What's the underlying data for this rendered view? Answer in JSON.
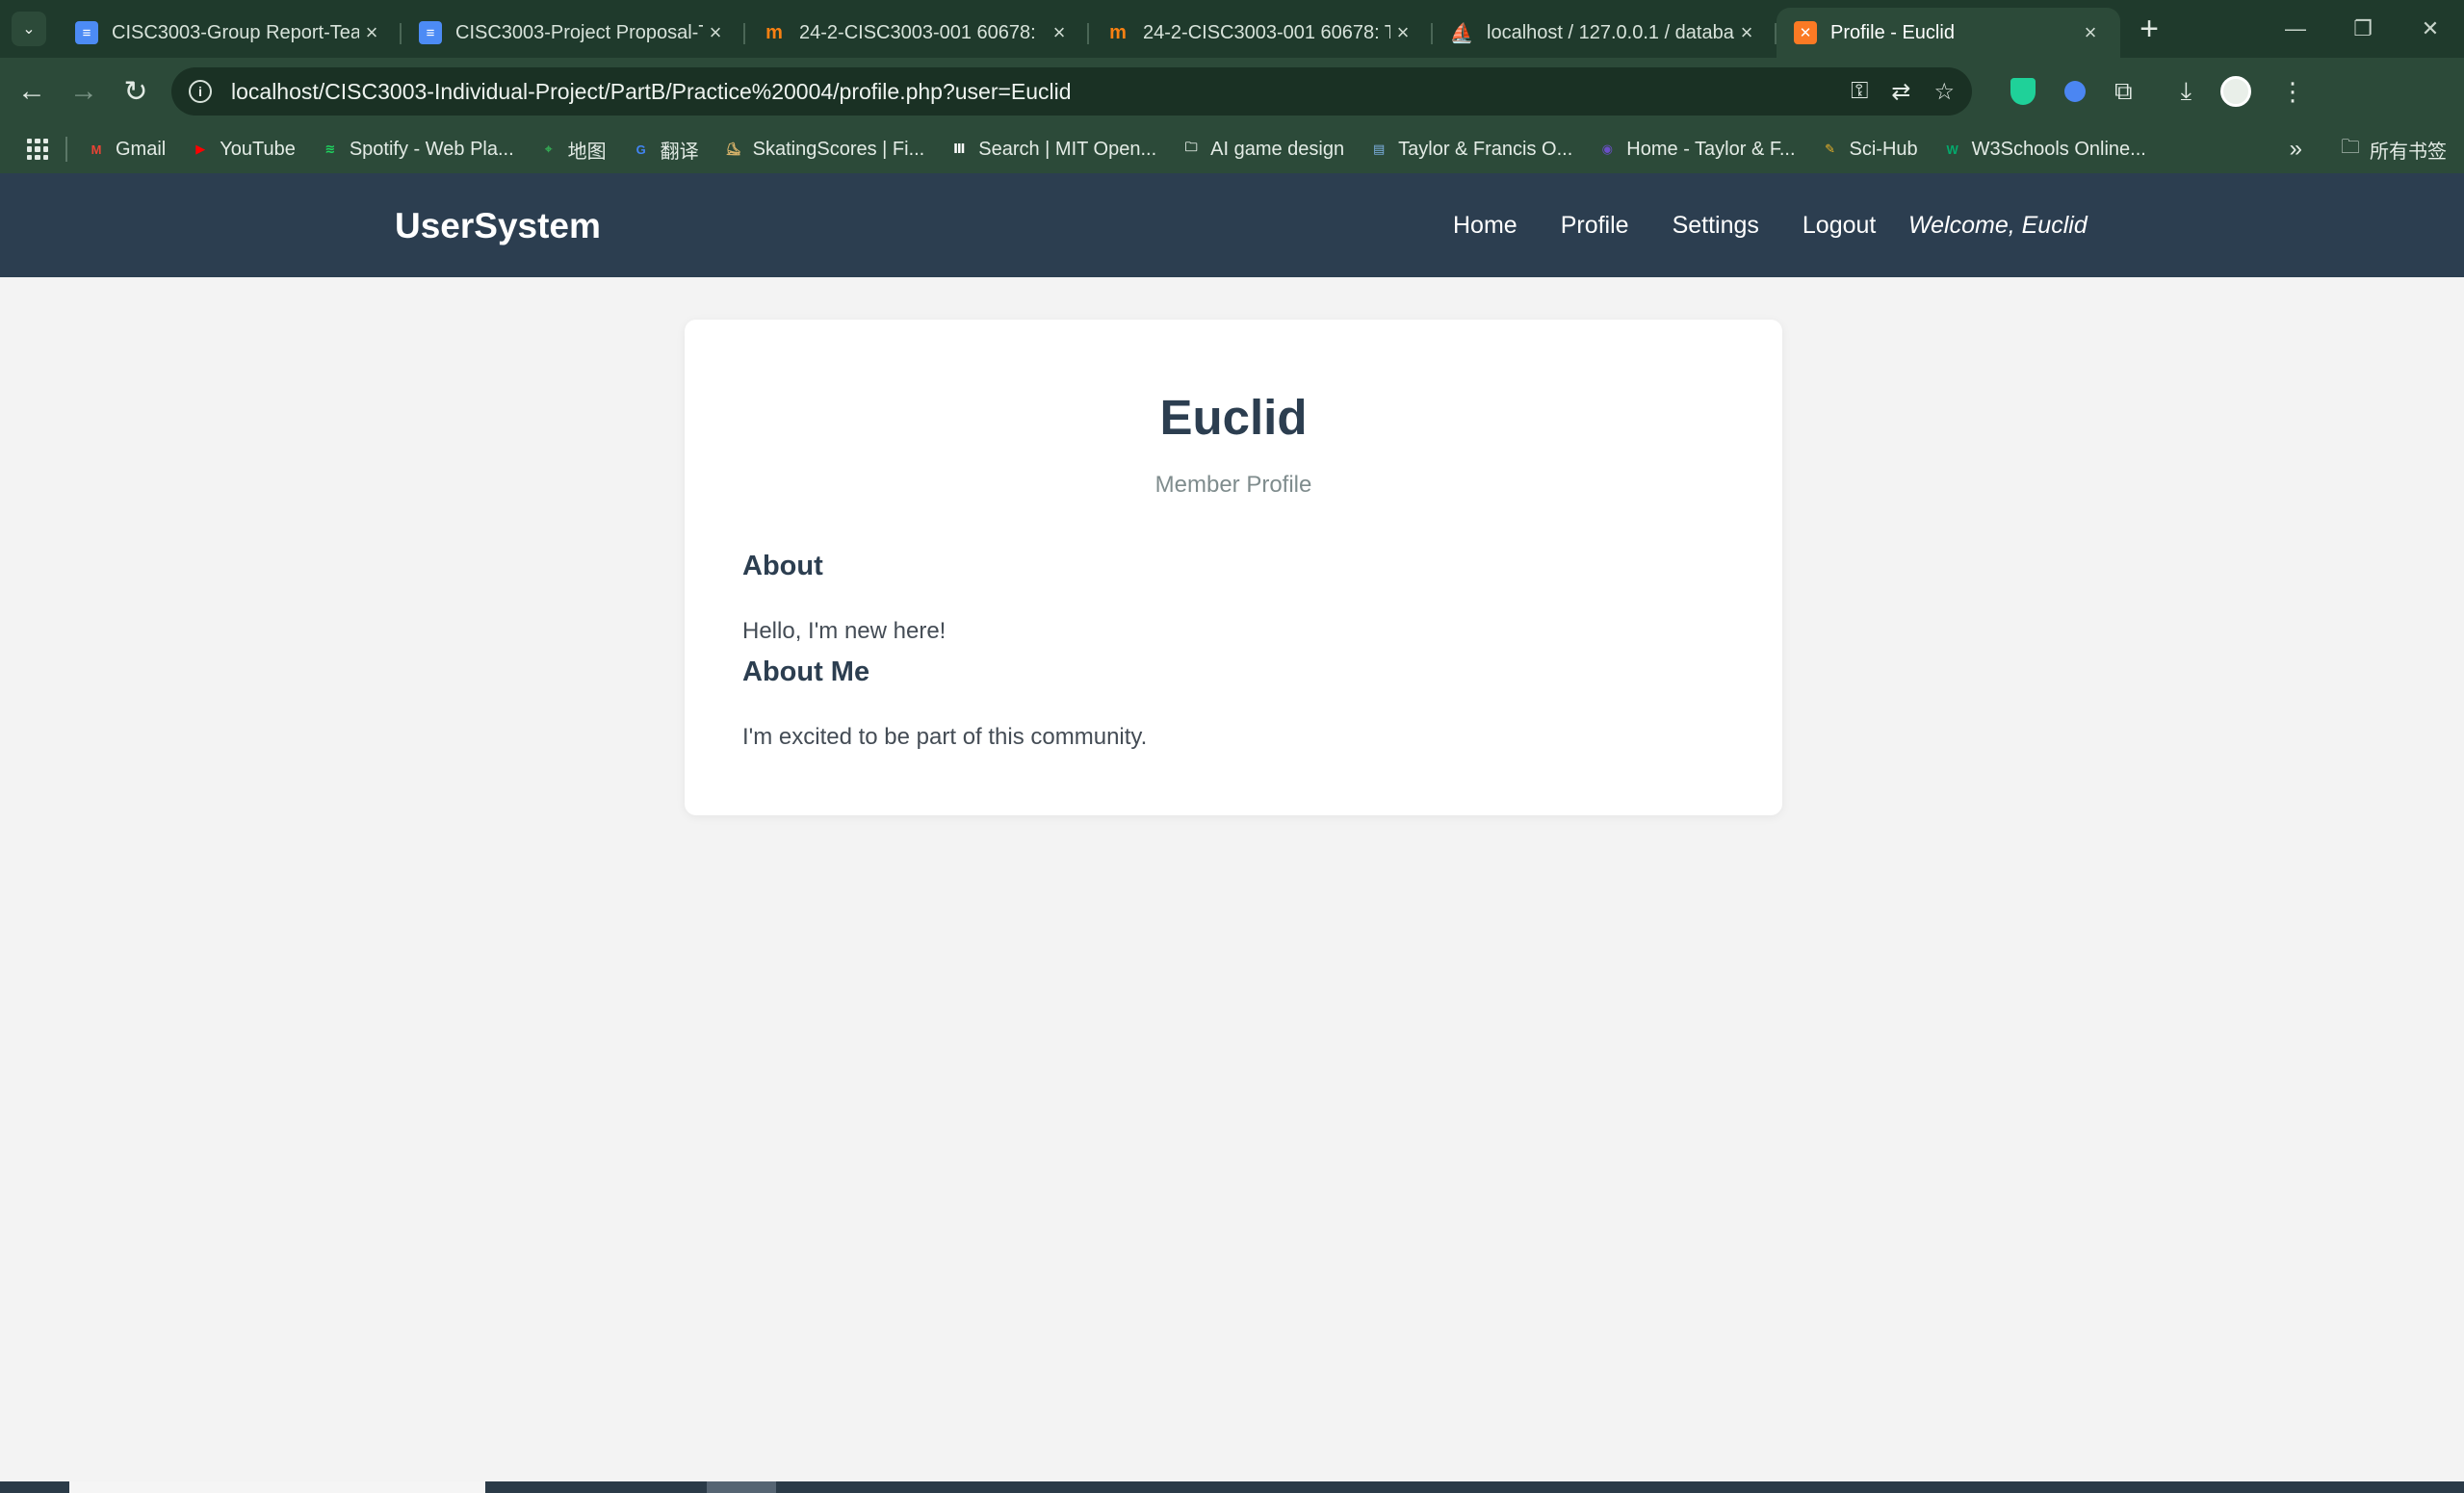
{
  "browser": {
    "tabs": [
      {
        "title": "CISC3003-Group Report-Team",
        "favicon": "google-docs-icon",
        "active": false
      },
      {
        "title": "CISC3003-Project Proposal-Te",
        "favicon": "google-docs-icon",
        "active": false
      },
      {
        "title": "24-2-CISC3003-001 60678: ",
        "favicon": "moodle-icon",
        "active": false
      },
      {
        "title": "24-2-CISC3003-001 60678: T",
        "favicon": "moodle-icon",
        "active": false
      },
      {
        "title": "localhost / 127.0.0.1 / databa",
        "favicon": "phpmyadmin-icon",
        "active": false
      },
      {
        "title": "Profile - Euclid",
        "favicon": "xampp-icon",
        "active": true
      }
    ],
    "url": "localhost/CISC3003-Individual-Project/PartB/Practice%20004/profile.php?user=Euclid",
    "bookmarks": [
      {
        "label": "Gmail",
        "icon": "gmail-icon",
        "color": "#ea4335"
      },
      {
        "label": "YouTube",
        "icon": "youtube-icon",
        "color": "#ff0000"
      },
      {
        "label": "Spotify - Web Pla...",
        "icon": "spotify-icon",
        "color": "#1ed760"
      },
      {
        "label": "地图",
        "icon": "maps-pin-icon",
        "color": "#34a853"
      },
      {
        "label": "翻译",
        "icon": "translate-icon",
        "color": "#4285f4"
      },
      {
        "label": "SkatingScores | Fi...",
        "icon": "skater-icon",
        "color": "#d9b36a"
      },
      {
        "label": "Search | MIT Open...",
        "icon": "mit-icon",
        "color": "#ffffff"
      },
      {
        "label": "AI game design",
        "icon": "folder-icon",
        "color": "#e3ebe5"
      },
      {
        "label": "Taylor & Francis O...",
        "icon": "taylor-francis-icon",
        "color": "#7fb2e5"
      },
      {
        "label": "Home - Taylor & F...",
        "icon": "taylor-francis-home-icon",
        "color": "#6a4fc7"
      },
      {
        "label": "Sci-Hub",
        "icon": "scihub-icon",
        "color": "#f0b429"
      },
      {
        "label": "W3Schools Online...",
        "icon": "w3schools-icon",
        "color": "#04aa6d"
      }
    ],
    "all_bookmarks_label": "所有书签"
  },
  "site": {
    "brand": "UserSystem",
    "nav": [
      "Home",
      "Profile",
      "Settings",
      "Logout"
    ],
    "welcome": "Welcome, Euclid",
    "colors": {
      "nav_bg": "#2c3e50",
      "page_bg": "#f3f3f3",
      "card_bg": "#ffffff"
    }
  },
  "profile": {
    "name": "Euclid",
    "subtitle": "Member Profile",
    "sections": [
      {
        "heading": "About",
        "text": "Hello, I'm new here!"
      },
      {
        "heading": "About Me",
        "text": "I'm excited to be part of this community."
      }
    ]
  }
}
